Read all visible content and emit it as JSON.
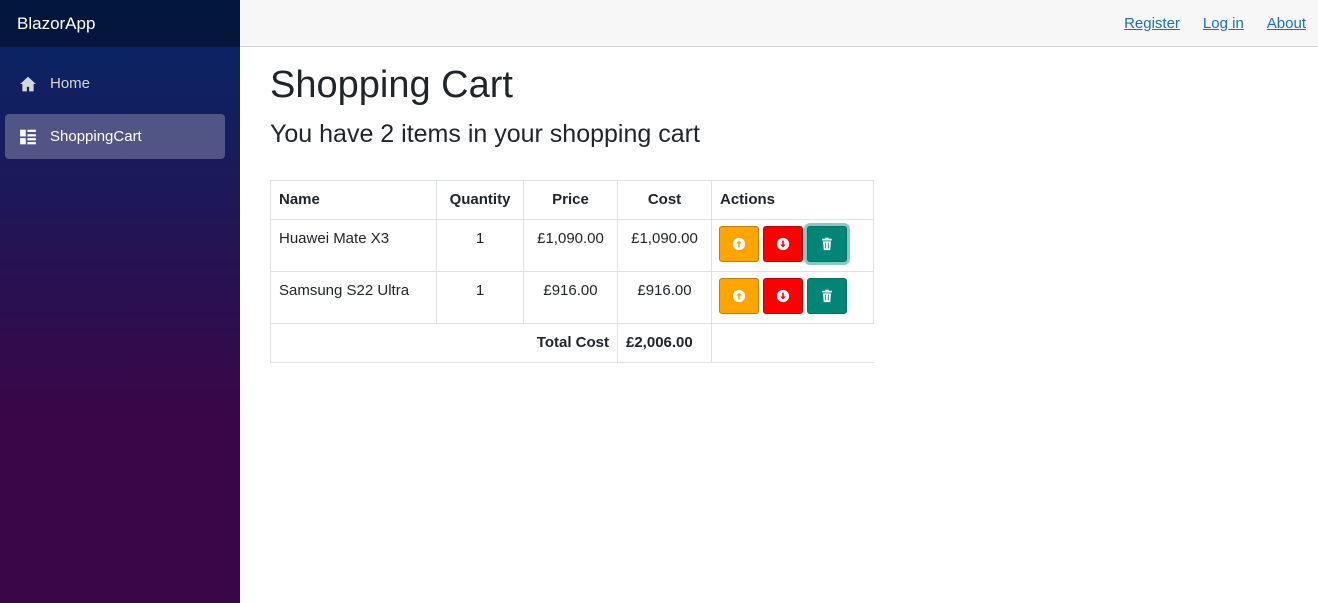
{
  "app": {
    "brand": "BlazorApp"
  },
  "sidebar": {
    "items": [
      {
        "label": "Home",
        "icon": "home-icon",
        "active": false
      },
      {
        "label": "ShoppingCart",
        "icon": "list-icon",
        "active": true
      }
    ]
  },
  "topbar": {
    "links": [
      "Register",
      "Log in",
      "About"
    ]
  },
  "main": {
    "title": "Shopping Cart",
    "subtitle": "You have 2 items in your shopping cart",
    "table": {
      "headers": [
        "Name",
        "Quantity",
        "Price",
        "Cost",
        "Actions"
      ],
      "rows": [
        {
          "name": "Huawei Mate X3",
          "quantity": "1",
          "price": "£1,090.00",
          "cost": "£1,090.00"
        },
        {
          "name": "Samsung S22 Ultra",
          "quantity": "1",
          "price": "£916.00",
          "cost": "£916.00"
        }
      ],
      "total_label": "Total Cost",
      "total_value": "£2,006.00"
    },
    "action_icons": {
      "increase": "arrow-up-circle-icon",
      "decrease": "arrow-down-circle-icon",
      "delete": "trash-icon"
    }
  },
  "colors": {
    "increase": "#ffa500",
    "decrease": "#ff0000",
    "delete": "#008577",
    "link": "#1b6ec2"
  }
}
